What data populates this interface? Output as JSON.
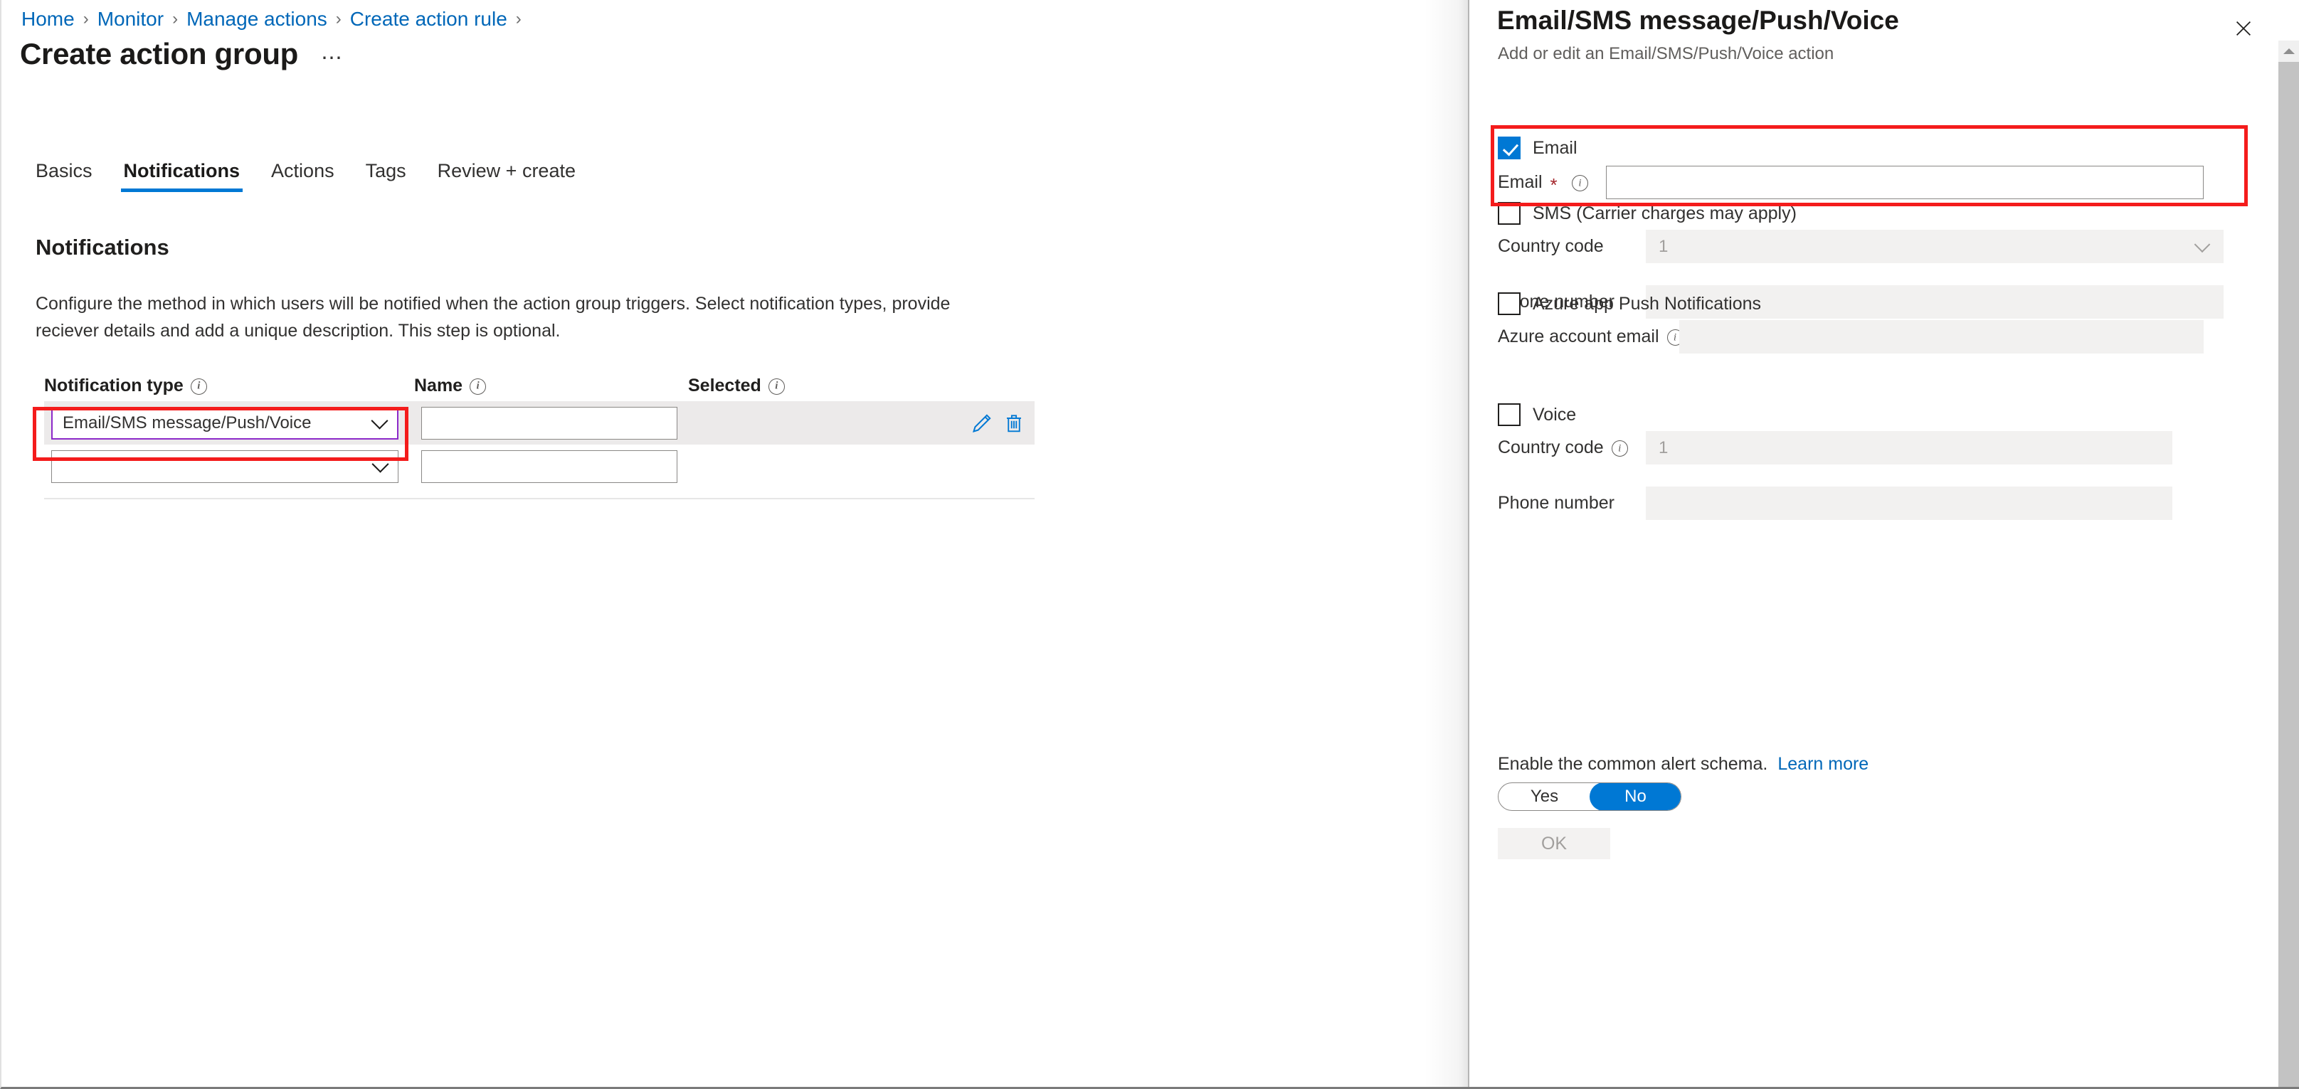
{
  "breadcrumb": {
    "items": [
      "Home",
      "Monitor",
      "Manage actions",
      "Create action rule"
    ],
    "separator": "›"
  },
  "page": {
    "title": "Create action group",
    "ellipsis": "…"
  },
  "tabs": [
    {
      "label": "Basics",
      "active": false
    },
    {
      "label": "Notifications",
      "active": true
    },
    {
      "label": "Actions",
      "active": false
    },
    {
      "label": "Tags",
      "active": false
    },
    {
      "label": "Review + create",
      "active": false
    }
  ],
  "notifications_section": {
    "heading": "Notifications",
    "description": "Configure the method in which users will be notified when the action group triggers. Select notification types, provide reciever details and add a unique description. This step is optional."
  },
  "table": {
    "headers": {
      "notification_type": "Notification type",
      "name": "Name",
      "selected": "Selected"
    },
    "rows": [
      {
        "notification_type_value": "Email/SMS message/Push/Voice",
        "name_value": "",
        "selected_value": "",
        "highlighted": true,
        "edit_icon": "pencil-icon",
        "delete_icon": "trash-icon"
      },
      {
        "notification_type_value": "",
        "name_value": "",
        "selected_value": "",
        "highlighted": false
      }
    ]
  },
  "blade": {
    "title": "Email/SMS message/Push/Voice",
    "subtitle": "Add or edit an Email/SMS/Push/Voice action",
    "close_icon": "close-icon",
    "email": {
      "checkbox_label": "Email",
      "checked": true,
      "field_label": "Email",
      "required_marker": "*",
      "value": "",
      "highlighted": true
    },
    "sms": {
      "checkbox_label": "SMS (Carrier charges may apply)",
      "checked": false,
      "country_code_label": "Country code",
      "country_code_value": "1",
      "phone_label": "Phone number",
      "phone_value": ""
    },
    "push": {
      "checkbox_label": "Azure app Push Notifications",
      "checked": false,
      "account_email_label": "Azure account email",
      "account_email_value": ""
    },
    "voice": {
      "checkbox_label": "Voice",
      "checked": false,
      "country_code_label": "Country code",
      "country_code_value": "1",
      "phone_label": "Phone number",
      "phone_value": ""
    },
    "schema": {
      "text": "Enable the common alert schema.",
      "learn_more": "Learn more",
      "option_yes": "Yes",
      "option_no": "No",
      "selected": "No"
    },
    "ok_label": "OK"
  },
  "colors": {
    "accent": "#0078d4",
    "link": "#0067b8",
    "highlight_red": "#f41c1c",
    "focus_purple": "#8c29c9",
    "required_red": "#a4262c",
    "row_selected_bg": "#eceaea",
    "disabled_bg": "#f2f1f0"
  }
}
